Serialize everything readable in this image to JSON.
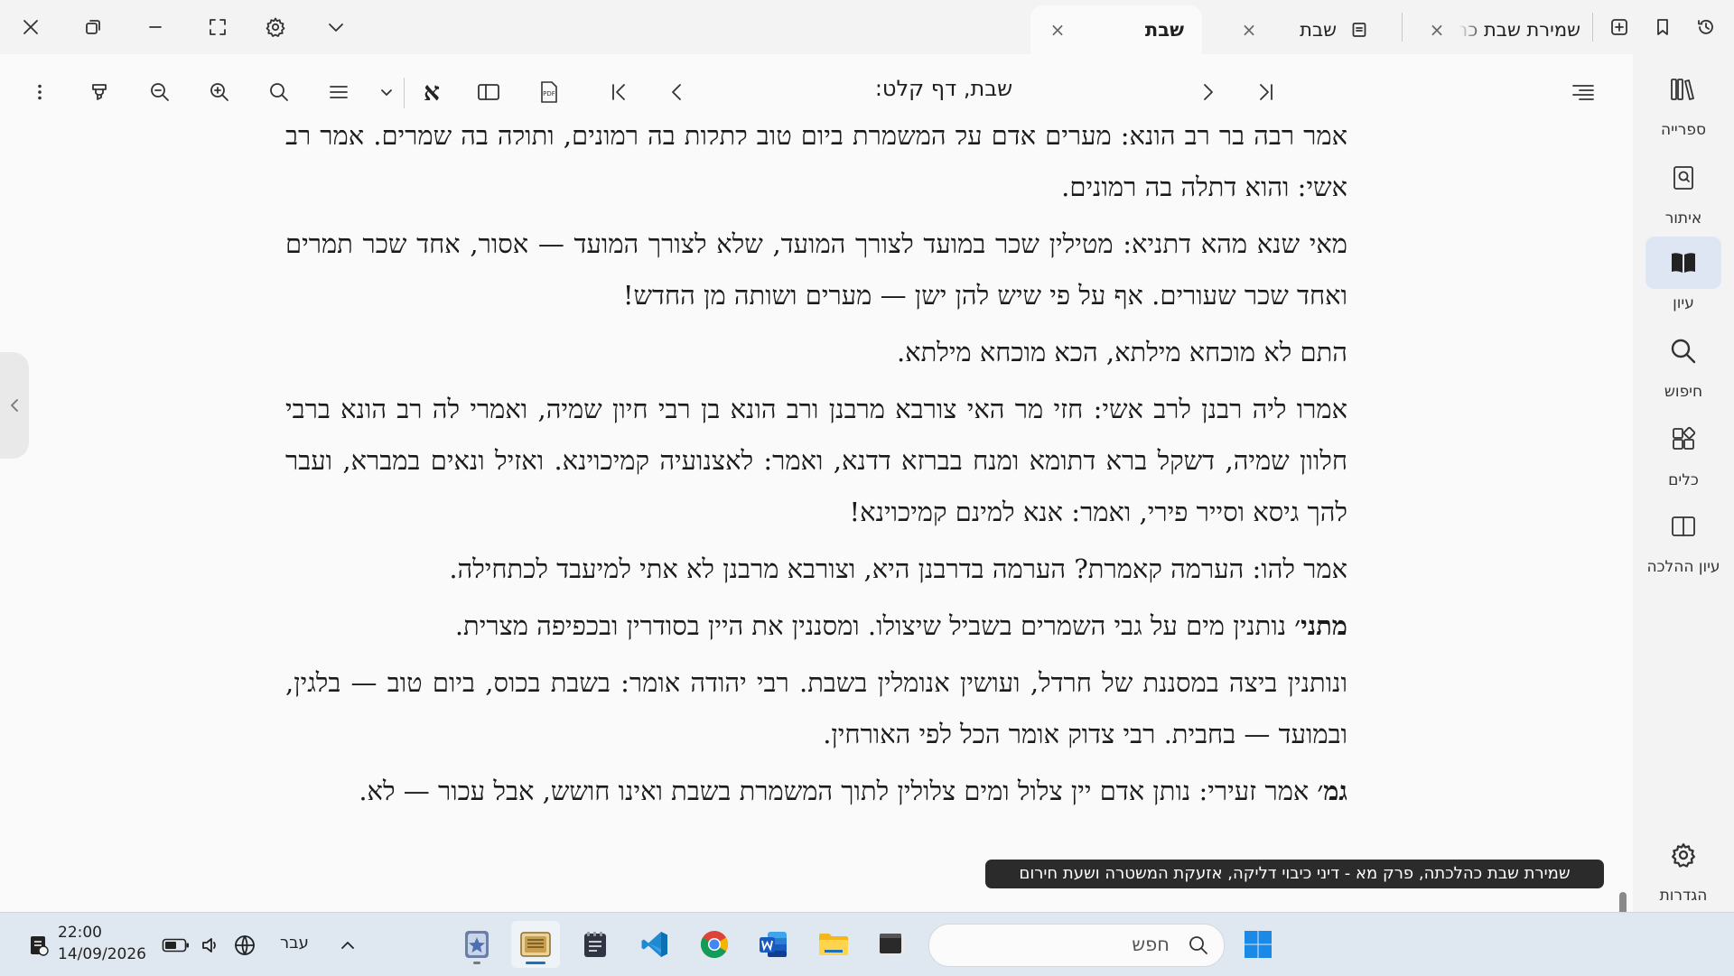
{
  "tabs": [
    {
      "label": "שבת",
      "active": true
    },
    {
      "label": "שבת",
      "active": false
    },
    {
      "label": "שמירת שבת כה",
      "active": false
    }
  ],
  "toolbar": {
    "title": "שבת, דף קלט:"
  },
  "content": {
    "paragraphs": [
      {
        "bold": "",
        "text": "אמר רבה בר רב הונא: מערים אדם על המשמרת ביום טוב לתלות בה רמונים, ותולה בה שמרים. אמר רב אשי: והוא דתלה בה רמונים."
      },
      {
        "bold": "",
        "text": "מאי שנא מהא דתניא: מטילין שכר במועד לצורך המועד, שלא לצורך המועד — אסור, אחד שכר תמרים ואחד שכר שעורים. אף על פי שיש להן ישן — מערים ושותה מן החדש!"
      },
      {
        "bold": "",
        "text": "התם לא מוכחא מילתא, הכא מוכחא מילתא."
      },
      {
        "bold": "",
        "text": "אמרו ליה רבנן לרב אשי: חזי מר האי צורבא מרבנן ורב הונא בן רבי חיון שמיה, ואמרי לה רב הונא ברבי חלוון שמיה, דשקל ברא דתומא ומנח בברזא דדנא, ואמר: לאצנועיה קמיכוינא. ואזיל ונאים במברא, ועבר להך גיסא וסייר פירי, ואמר: אנא למינם קמיכוינא!"
      },
      {
        "bold": "",
        "text": "אמר להו: הערמה קאמרת? הערמה בדרבנן היא, וצורבא מרבנן לא אתי למיעבד לכתחילה."
      },
      {
        "bold": "מתני׳",
        "text": " נותנין מים על גבי השמרים בשביל שיצולו. ומסננין את היין בסודרין ובכפיפה מצרית."
      },
      {
        "bold": "",
        "text": "ונותנין ביצה במסננת של חרדל, ועושין אנומלין בשבת. רבי יהודה אומר: בשבת בכוס, ביום טוב — בלגין, ובמועד — בחבית. רבי צדוק אומר הכל לפי האורחין."
      },
      {
        "bold": "גמ׳",
        "text": " אמר זעירי: נותן אדם יין צלול ומים צלולין לתוך המשמרת בשבת ואינו חושש, אבל עכור — לא."
      }
    ]
  },
  "tooltip": "שמירת שבת כהלכתה, פרק מא - דיני כיבוי דליקה, אזעקת המשטרה ושעת חירום",
  "nav": [
    {
      "label": "ספרייה",
      "icon": "library-icon"
    },
    {
      "label": "איתור",
      "icon": "locate-book-icon"
    },
    {
      "label": "עיון",
      "icon": "open-book-icon",
      "active": true
    },
    {
      "label": "חיפוש",
      "icon": "search-icon"
    },
    {
      "label": "כלים",
      "icon": "tools-icon"
    },
    {
      "label": "עיון ההלכה",
      "icon": "halacha-view-icon"
    },
    {
      "label": "הגדרות",
      "icon": "gear-icon"
    }
  ],
  "taskbar": {
    "search_placeholder": "חפש",
    "language": "עבר",
    "time": "22:00",
    "date": "14/09/2026",
    "apps": [
      "copilot-app-icon",
      "otzaria-app-icon",
      "notepad-app-icon",
      "vscode-app-icon",
      "chrome-app-icon",
      "word-app-icon",
      "file-explorer-app-icon",
      "terminal-app-icon",
      "start-icon"
    ]
  },
  "colors": {
    "accent": "#1d6fb8",
    "nav_active_bg": "#dde6f2",
    "background": "#fafafa",
    "chrome": "#f3f3f3",
    "taskbar": "#dfe8f1"
  }
}
